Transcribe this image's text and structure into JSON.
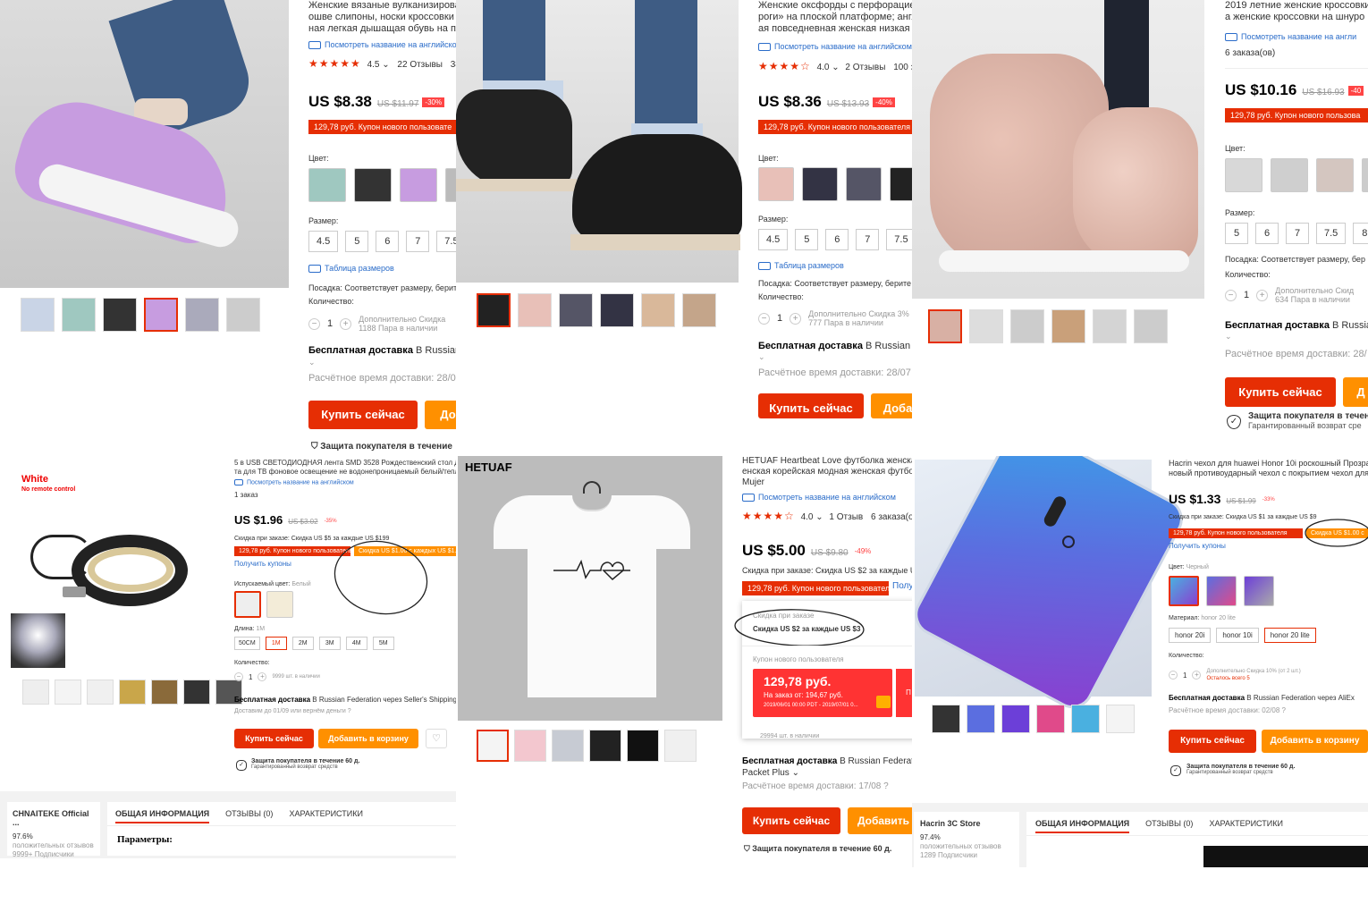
{
  "p1": {
    "title_lines": [
      "Женские вязаные вулканизированные",
      "ошве слипоны, носки кроссовки ж",
      "ная легкая дышащая обувь на пла"
    ],
    "translate": "Посмотреть название на английском",
    "rating": "4.5",
    "reviews": "22 Отзывы",
    "orders": "38",
    "price": "US $8.38",
    "old_price": "US $11.97",
    "discount": "-30%",
    "coupon": "129,78 руб. Купон нового пользовате",
    "color_label": "Цвет:",
    "size_label": "Размер:",
    "sizes": [
      "4.5",
      "5",
      "6",
      "7",
      "7.5"
    ],
    "size_table": "Таблица размеров",
    "fit": "Посадка: Соответствует размеру, берите",
    "qty_label": "Количество:",
    "qty": "1",
    "extra": "Дополнительно Скидка",
    "stock": "1188 Пара в наличии",
    "ship_bold": "Бесплатная доставка",
    "ship_rest": " В Russian F",
    "eta": "Расчётное время доставки: 28/07",
    "buy": "Купить сейчас",
    "cart": "Доб",
    "protection": "Защита покупателя в течение"
  },
  "p2": {
    "title_lines": [
      "Женские оксфорды с перфорацией",
      "роги» на плоской платформе; англ",
      "ая повседневная женская низкая об"
    ],
    "translate": "Посмотреть название на английском",
    "rating": "4.0",
    "reviews": "2 Отзывы",
    "orders": "100 за",
    "price": "US $8.36",
    "old_price": "US $13.93",
    "discount": "-40%",
    "coupon": "129,78 руб. Купон нового пользователя",
    "color_label": "Цвет:",
    "size_label": "Размер:",
    "sizes": [
      "4.5",
      "5",
      "6",
      "7",
      "7.5"
    ],
    "size_table": "Таблица размеров",
    "fit": "Посадка: Соответствует размеру, берите с",
    "qty_label": "Количество:",
    "qty": "1",
    "extra": "Дополнительно Скидка 3%",
    "stock": "777 Пара в наличии",
    "ship_bold": "Бесплатная доставка",
    "ship_rest": " В Russian Fe",
    "eta": "Расчётное время доставки: 28/07",
    "buy": "Купить сейчас",
    "cart": "Доба"
  },
  "p3": {
    "title_lines": [
      "2019 летние женские кроссовки",
      "а женские кроссовки на шнуро"
    ],
    "translate": "Посмотреть название на англи",
    "orders": "6 заказа(ов)",
    "price": "US $10.16",
    "old_price": "US $16.93",
    "discount": "-40",
    "coupon": "129,78 руб. Купон нового пользова",
    "color_label": "Цвет:",
    "size_label": "Размер:",
    "sizes": [
      "5",
      "6",
      "7",
      "7.5",
      "8"
    ],
    "fit": "Посадка: Соответствует размеру, бер",
    "qty_label": "Количество:",
    "qty": "1",
    "extra": "Дополнительно Скид",
    "stock": "634 Пара в наличии",
    "ship_bold": "Бесплатная доставка",
    "ship_rest": " В Russia",
    "eta": "Расчётное время доставки: 28/",
    "buy": "Купить сейчас",
    "cart": "Д",
    "protection": "Защита покупателя в течен",
    "protection_sub": "Гарантированный возврат сре"
  },
  "p4": {
    "img_title": "White",
    "img_sub": "No remote control",
    "title_lines": [
      "5 в USB СВЕТОДИОДНАЯ лента SMD 3528 Рождественский стол Декор",
      "та для ТВ фоновое освещение не водонепроницаемый белый/тепль"
    ],
    "translate": "Посмотреть название на английском",
    "orders": "1 заказ",
    "price": "US $1.96",
    "old_price": "US $3.02",
    "discount": "-35%",
    "order_disc": "Скидка при заказе: Скидка US $5 за каждые US $199",
    "coupon": "129,78 руб. Купон нового пользователя",
    "coupon2": "Скидка US $1.00 с каждых US $1.01",
    "get_coupons": "Получить купоны",
    "color_label": "Испускаемый цвет:",
    "color_value": "Белый",
    "len_label": "Длина:",
    "len_value": "1M",
    "lengths": [
      "50CM",
      "1M",
      "2M",
      "3M",
      "4M",
      "5M"
    ],
    "qty_label": "Количество:",
    "qty": "1",
    "stock": "9999 шт. в наличии",
    "ship_bold": "Бесплатная доставка",
    "ship_rest": " В Russian Federation через Seller's Shipping Me",
    "delivery": "Доставим до 01/09 или вернём деньги",
    "buy": "Купить сейчас",
    "cart": "Добавить в корзину",
    "protection": "Защита покупателя в течение 60 д.",
    "protection_sub": "Гарантированный возврат средств",
    "store_name": "CHNAITEKE Official ...",
    "store_pct": "97.6%",
    "store_pos": "положительных отзывов",
    "store_subs": "9999+ Подписчики",
    "tabs": [
      "ОБЩАЯ ИНФОРМАЦИЯ",
      "ОТЗЫВЫ (0)",
      "ХАРАКТЕРИСТИКИ"
    ],
    "params": "Параметры:"
  },
  "p5": {
    "brand": "HETUAF",
    "title_lines": [
      "HETUAF Heartbeat Love футболка женская с",
      "енская корейская модная женская футбол",
      "Mujer"
    ],
    "translate": "Посмотреть название на английском",
    "rating": "4.0",
    "reviews": "1 Отзыв",
    "orders": "6 заказа(ов)",
    "price": "US $5.00",
    "old_price": "US $9.80",
    "discount": "-49%",
    "order_disc": "Скидка при заказе: Скидка US $2 за каждые US $3",
    "coupon": "129,78 руб. Купон нового пользователя",
    "more": "Полу",
    "popup_label": "Скидка при заказе",
    "popup_text": "Скидка US $2 за каждые US $3",
    "popup_coupon_label": "Купон нового пользователя",
    "popup_amount": "129,78 руб.",
    "popup_order": "На заказ от: 194,67 руб.",
    "popup_dates": "2019/06/01 00:00 PDT - 2019/07/01 0...",
    "popup_btn": "П",
    "stock": "29994 шт. в наличии",
    "ship_bold": "Бесплатная доставка",
    "ship_rest": " В Russian Federatio",
    "ship_line2": "Packet Plus",
    "eta": "Расчётное время доставки: 17/08",
    "buy": "Купить сейчас",
    "cart": "Добавить",
    "protection": "Защита покупателя в течение 60 д."
  },
  "p6": {
    "title_lines": [
      "Hacrin чехол для huawei Honor 10i роскошный Прозрач",
      "новый противоударный чехол с покрытием чехол для"
    ],
    "price": "US $1.33",
    "old_price": "US $1.99",
    "discount": "-33%",
    "order_disc": "Скидка при заказе: Скидка US $1 за каждые US $9",
    "coupon": "129,78 руб. Купон нового пользователя",
    "coupon2": "Скидка US $1.00 с",
    "get_coupons": "Получить купоны",
    "color_label": "Цвет:",
    "color_value": "Черный",
    "mat_label": "Материал:",
    "mat_value": "honor 20 lite",
    "materials": [
      "honor 20i",
      "honor 10i",
      "honor 20 lite"
    ],
    "qty_label": "Количество:",
    "qty": "1",
    "extra": "Дополнительно Скидка 10% (от 2 шт.)",
    "left": "Осталось всего 5",
    "ship_bold": "Бесплатная доставка",
    "ship_rest": " В Russian Federation через AliEx",
    "eta": "Расчётное время доставки: 02/08",
    "buy": "Купить сейчас",
    "cart": "Добавить в корзину",
    "protection": "Защита покупателя в течение 60 д.",
    "protection_sub": "Гарантированный возврат средств",
    "store_name": "Hacrin 3C Store",
    "store_pct": "97.4%",
    "store_pos": "положительных отзывов",
    "store_subs": "1289 Подписчики",
    "tabs": [
      "ОБЩАЯ ИНФОРМАЦИЯ",
      "ОТЗЫВЫ (0)",
      "ХАРАКТЕРИСТИКИ"
    ]
  }
}
